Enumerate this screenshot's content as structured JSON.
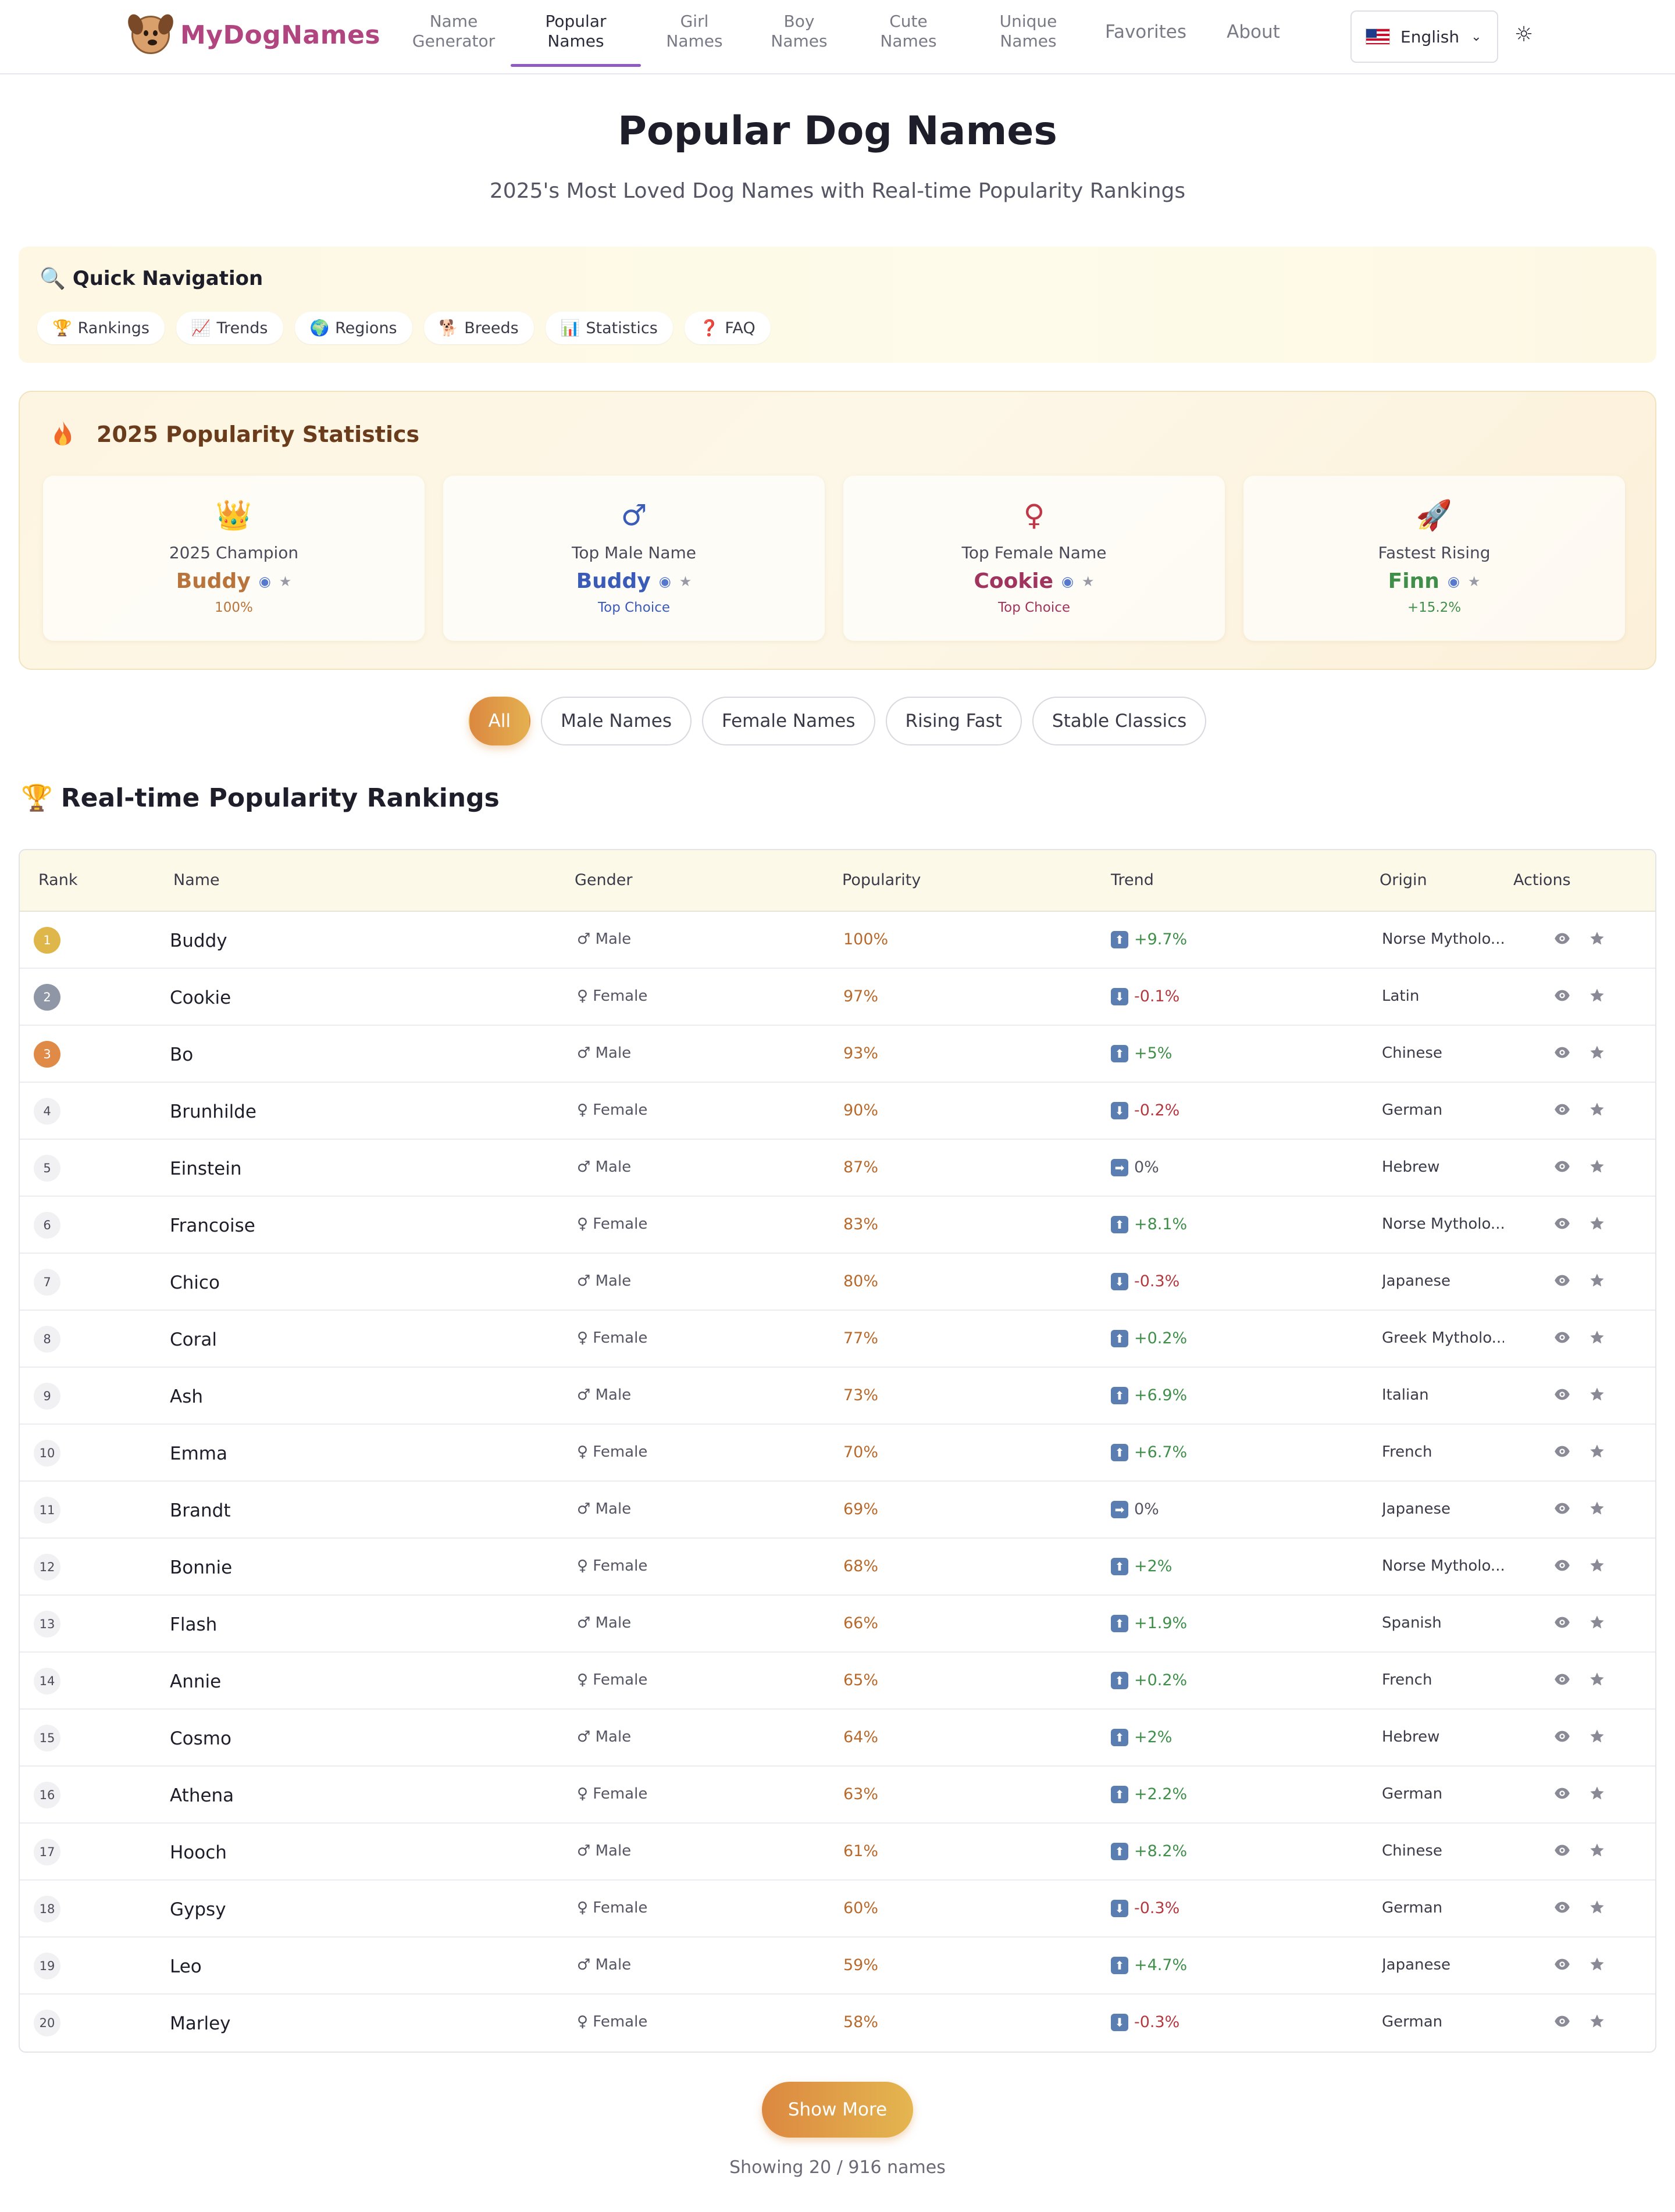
{
  "brand": {
    "name": "MyDogNames"
  },
  "nav": {
    "items": [
      {
        "label_1": "Name",
        "label_2": "Generator"
      },
      {
        "label_1": "Popular",
        "label_2": "Names"
      },
      {
        "label_1": "Girl",
        "label_2": "Names"
      },
      {
        "label_1": "Boy",
        "label_2": "Names"
      },
      {
        "label_1": "Cute",
        "label_2": "Names"
      },
      {
        "label_1": "Unique",
        "label_2": "Names"
      }
    ],
    "favorites": "Favorites",
    "about": "About",
    "active_index": 1,
    "language": "English"
  },
  "header": {
    "title": "Popular Dog Names",
    "subtitle": "2025's Most Loved Dog Names with Real-time Popularity Rankings"
  },
  "quick_nav": {
    "title": "Quick Navigation",
    "chips": [
      {
        "icon": "🏆",
        "label": "Rankings"
      },
      {
        "icon": "📈",
        "label": "Trends"
      },
      {
        "icon": "🌍",
        "label": "Regions"
      },
      {
        "icon": "🐕",
        "label": "Breeds"
      },
      {
        "icon": "📊",
        "label": "Statistics"
      },
      {
        "icon": "❓",
        "label": "FAQ"
      }
    ]
  },
  "stats": {
    "title": "2025 Popularity Statistics",
    "cards": [
      {
        "icon": "👑",
        "label": "2025 Champion",
        "name": "Buddy",
        "sub": "100%",
        "color": "#b8743a"
      },
      {
        "icon": "♂",
        "label": "Top Male Name",
        "name": "Buddy",
        "sub": "Top Choice",
        "color": "#3a5bb8"
      },
      {
        "icon": "♀",
        "label": "Top Female Name",
        "name": "Cookie",
        "sub": "Top Choice",
        "color": "#a0345f"
      },
      {
        "icon": "🚀",
        "label": "Fastest Rising",
        "name": "Finn",
        "sub": "+15.2%",
        "color": "#3f8f4a"
      }
    ]
  },
  "filters": [
    "All",
    "Male Names",
    "Female Names",
    "Rising Fast",
    "Stable Classics"
  ],
  "rankings": {
    "title": "Real-time Popularity Rankings",
    "columns": [
      "Rank",
      "Name",
      "Gender",
      "Popularity",
      "Trend",
      "Origin",
      "Actions"
    ],
    "rows": [
      {
        "rank": "1",
        "name": "Buddy",
        "gender": "♂ Male",
        "popularity": "100%",
        "trend": "+9.7%",
        "dir": "up",
        "origin": "Norse Mytholo..."
      },
      {
        "rank": "2",
        "name": "Cookie",
        "gender": "♀ Female",
        "popularity": "97%",
        "trend": "-0.1%",
        "dir": "down",
        "origin": "Latin"
      },
      {
        "rank": "3",
        "name": "Bo",
        "gender": "♂ Male",
        "popularity": "93%",
        "trend": "+5%",
        "dir": "up",
        "origin": "Chinese"
      },
      {
        "rank": "4",
        "name": "Brunhilde",
        "gender": "♀ Female",
        "popularity": "90%",
        "trend": "-0.2%",
        "dir": "down",
        "origin": "German"
      },
      {
        "rank": "5",
        "name": "Einstein",
        "gender": "♂ Male",
        "popularity": "87%",
        "trend": "0%",
        "dir": "flat",
        "origin": "Hebrew"
      },
      {
        "rank": "6",
        "name": "Francoise",
        "gender": "♀ Female",
        "popularity": "83%",
        "trend": "+8.1%",
        "dir": "up",
        "origin": "Norse Mytholo..."
      },
      {
        "rank": "7",
        "name": "Chico",
        "gender": "♂ Male",
        "popularity": "80%",
        "trend": "-0.3%",
        "dir": "down",
        "origin": "Japanese"
      },
      {
        "rank": "8",
        "name": "Coral",
        "gender": "♀ Female",
        "popularity": "77%",
        "trend": "+0.2%",
        "dir": "up",
        "origin": "Greek Mytholo..."
      },
      {
        "rank": "9",
        "name": "Ash",
        "gender": "♂ Male",
        "popularity": "73%",
        "trend": "+6.9%",
        "dir": "up",
        "origin": "Italian"
      },
      {
        "rank": "10",
        "name": "Emma",
        "gender": "♀ Female",
        "popularity": "70%",
        "trend": "+6.7%",
        "dir": "up",
        "origin": "French"
      },
      {
        "rank": "11",
        "name": "Brandt",
        "gender": "♂ Male",
        "popularity": "69%",
        "trend": "0%",
        "dir": "flat",
        "origin": "Japanese"
      },
      {
        "rank": "12",
        "name": "Bonnie",
        "gender": "♀ Female",
        "popularity": "68%",
        "trend": "+2%",
        "dir": "up",
        "origin": "Norse Mytholo..."
      },
      {
        "rank": "13",
        "name": "Flash",
        "gender": "♂ Male",
        "popularity": "66%",
        "trend": "+1.9%",
        "dir": "up",
        "origin": "Spanish"
      },
      {
        "rank": "14",
        "name": "Annie",
        "gender": "♀ Female",
        "popularity": "65%",
        "trend": "+0.2%",
        "dir": "up",
        "origin": "French"
      },
      {
        "rank": "15",
        "name": "Cosmo",
        "gender": "♂ Male",
        "popularity": "64%",
        "trend": "+2%",
        "dir": "up",
        "origin": "Hebrew"
      },
      {
        "rank": "16",
        "name": "Athena",
        "gender": "♀ Female",
        "popularity": "63%",
        "trend": "+2.2%",
        "dir": "up",
        "origin": "German"
      },
      {
        "rank": "17",
        "name": "Hooch",
        "gender": "♂ Male",
        "popularity": "61%",
        "trend": "+8.2%",
        "dir": "up",
        "origin": "Chinese"
      },
      {
        "rank": "18",
        "name": "Gypsy",
        "gender": "♀ Female",
        "popularity": "60%",
        "trend": "-0.3%",
        "dir": "down",
        "origin": "German"
      },
      {
        "rank": "19",
        "name": "Leo",
        "gender": "♂ Male",
        "popularity": "59%",
        "trend": "+4.7%",
        "dir": "up",
        "origin": "Japanese"
      },
      {
        "rank": "20",
        "name": "Marley",
        "gender": "♀ Female",
        "popularity": "58%",
        "trend": "-0.3%",
        "dir": "down",
        "origin": "German"
      }
    ]
  },
  "footer": {
    "show_more": "Show More",
    "showing": "Showing 20 / 916 names"
  },
  "colors": {
    "brand": "#b0457f",
    "accent": "#dc8840",
    "nav_active_underline": "#8e5bc2"
  }
}
